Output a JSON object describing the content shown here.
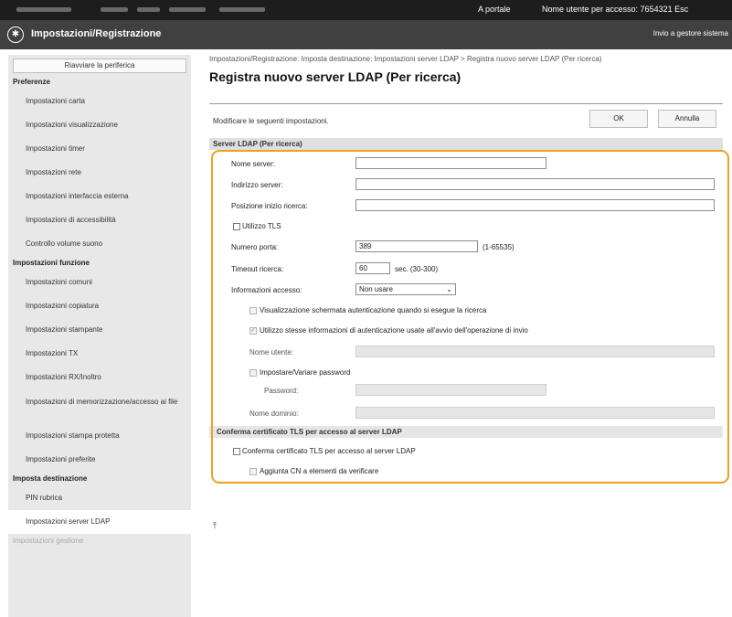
{
  "topbar": {
    "portal_link": "A portale",
    "user_info": "Nome utente per accesso:  7654321  Esc"
  },
  "header": {
    "app_title": "Impostazioni/Registrazione",
    "send_to_admin": "Invio a gestore sistema"
  },
  "sidebar": {
    "restart_label": "Riavviare la periferica",
    "sections": [
      {
        "title": "Preferenze",
        "items": [
          "Impostazioni carta",
          "Impostazioni visualizzazione",
          "Impostazioni timer",
          "Impostazioni rete",
          "Impostazioni interfaccia esterna",
          "Impostazioni di accessibilità",
          "Controllo volume suono"
        ]
      },
      {
        "title": "Impostazioni funzione",
        "items": [
          "Impostazioni comuni",
          "Impostazioni copiatura",
          "Impostazioni stampante",
          "Impostazioni TX",
          "Impostazioni RX/Inoltro",
          "Impostazioni di memorizzazione/accesso ai file",
          "Impostazioni stampa protetta",
          "Impostazioni preferite"
        ]
      },
      {
        "title": "Imposta destinazione",
        "items": [
          "PIN rubrica",
          "Impostazioni server LDAP"
        ]
      },
      {
        "title": "Impostazioni gestione",
        "items": []
      }
    ]
  },
  "main": {
    "breadcrumb": "Impostazioni/Registrazione: Imposta destinazione: Impostazioni server LDAP > Registra nuovo server LDAP (Per ricerca)",
    "page_title": "Registra nuovo server LDAP (Per ricerca)",
    "instruction": "Modificare le seguenti impostazioni.",
    "ok_label": "OK",
    "cancel_label": "Annulla",
    "section_title": "Server LDAP (Per ricerca)",
    "fields": {
      "server_name_label": "Nome server:",
      "server_name_value": "",
      "server_address_label": "Indirizzo server:",
      "server_address_value": "",
      "search_root_label": "Posizione inizio ricerca:",
      "search_root_value": "",
      "use_tls_label": "Utilizzo TLS",
      "port_label": "Numero porta:",
      "port_value": "389",
      "port_range": "(1-65535)",
      "timeout_label": "Timeout ricerca:",
      "timeout_value": "60",
      "timeout_range": "sec. (30-300)",
      "login_info_label": "Informazioni accesso:",
      "login_info_value": "Non usare",
      "show_auth_screen_label": "Visualizzazione schermata autenticazione quando si esegue la ricerca",
      "use_same_auth_label": "Utilizzo stesse informazioni di autenticazione usate all'avvio dell'operazione di invio",
      "user_name_label": "Nome utente:",
      "set_password_label": "Impostare/Variare password",
      "password_label": "Password:",
      "domain_name_label": "Nome dominio:"
    },
    "tls_section_title": "Conferma certificato TLS per accesso al server LDAP",
    "tls_confirm_label": "Conferma certificato TLS per accesso al server LDAP",
    "add_cn_label": "Aggiunta CN a elementi da verificare",
    "to_top_icon": "back-to-top-icon",
    "highlight_color": "#f0a020"
  }
}
